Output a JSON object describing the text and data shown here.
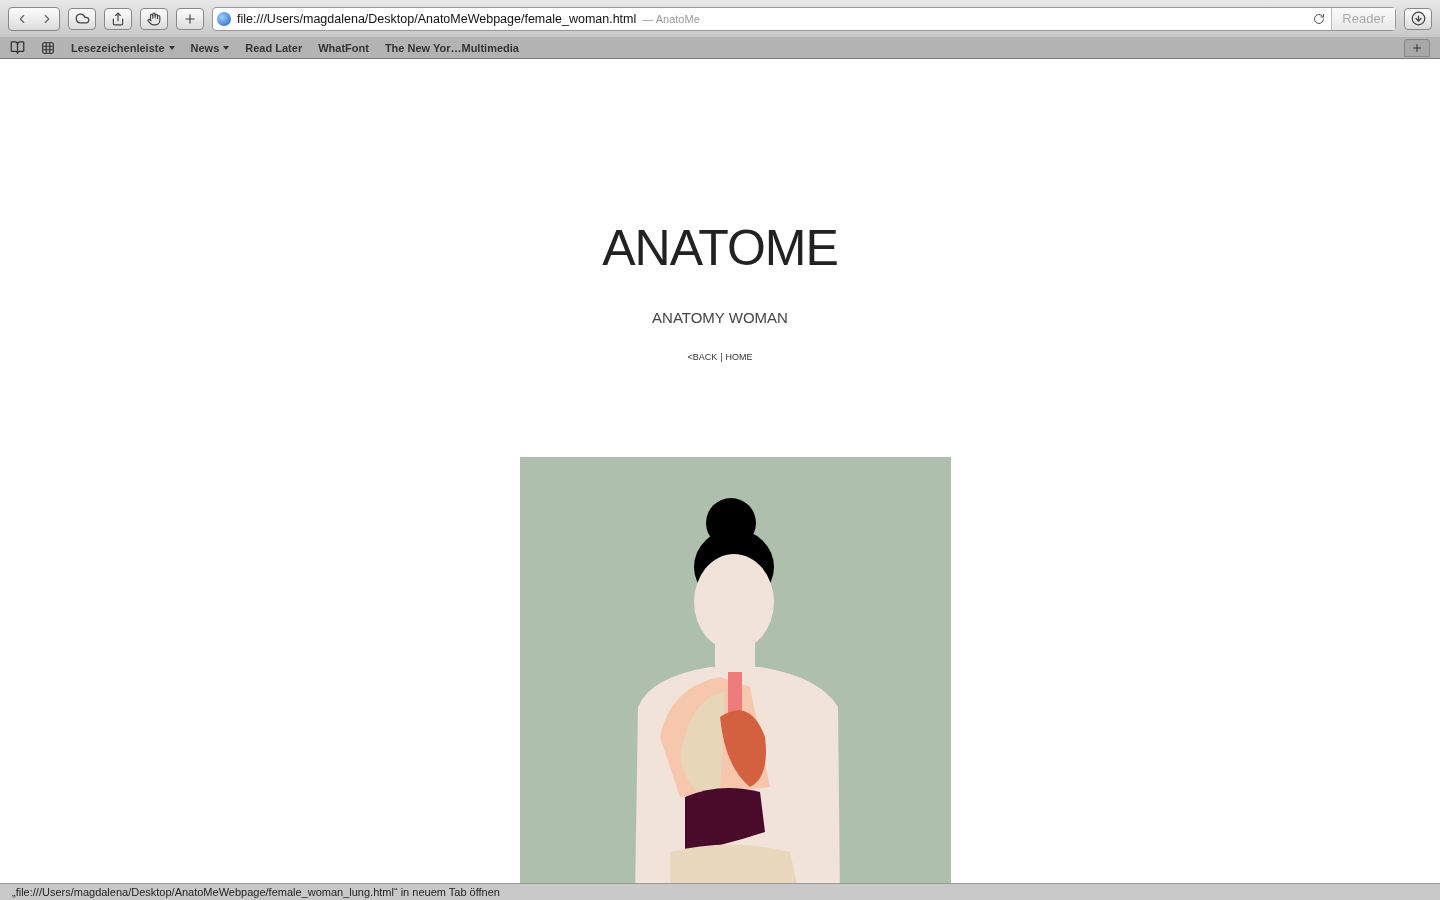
{
  "toolbar": {
    "address": "file:///Users/magdalena/Desktop/AnatoMeWebpage/female_woman.html",
    "page_title": "— AnatoMe",
    "reader": "Reader"
  },
  "bookmarks": [
    {
      "label": "Lesezeichenleiste",
      "menu": true
    },
    {
      "label": "News",
      "menu": true
    },
    {
      "label": "Read Later",
      "menu": false
    },
    {
      "label": "WhatFont",
      "menu": false
    },
    {
      "label": "The New Yor…Multimedia",
      "menu": false
    }
  ],
  "page": {
    "title": "ANATOME",
    "subtitle": "ANATOMY WOMAN",
    "links": [
      {
        "label": "<BACK"
      },
      {
        "label": "HOME"
      }
    ],
    "separator": "|"
  },
  "status_bar": "„file:///Users/magdalena/Desktop/AnatoMeWebpage/female_woman_lung.html“ in neuem Tab öffnen"
}
